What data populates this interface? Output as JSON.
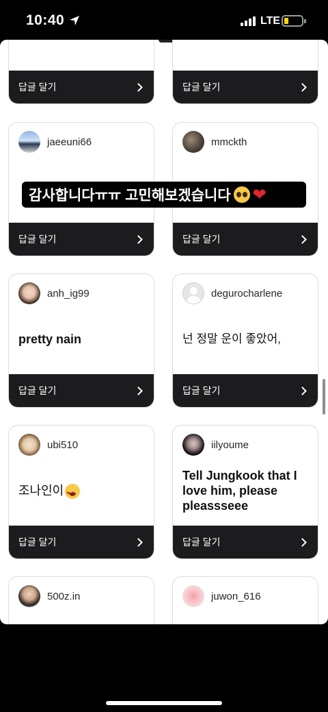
{
  "status_bar": {
    "time": "10:40",
    "network": "LTE",
    "location_icon": "location-arrow-icon",
    "battery_level": 0.2
  },
  "caption": {
    "text": "감사합니다ㅠㅠ 고민해보겠습니다",
    "emojis": [
      "pleading-face",
      "red-heart"
    ]
  },
  "reply_label": "답글 달기",
  "cards": [
    {
      "username": "",
      "message": ""
    },
    {
      "username": "",
      "message": ""
    },
    {
      "username": "jaeeuni66",
      "message": ""
    },
    {
      "username": "mmckth",
      "message": ""
    },
    {
      "username": "anh_ig99",
      "message": "pretty nain"
    },
    {
      "username": "degurocharlene",
      "message": "넌 정말 운이 좋았어,"
    },
    {
      "username": "ubi510",
      "message": "조나인이"
    },
    {
      "username": "iilyoume",
      "message": "Tell Jungkook that I love him, please pleassseee"
    },
    {
      "username": "500z.in",
      "message": ""
    },
    {
      "username": "juwon_616",
      "message": ""
    }
  ],
  "colors": {
    "footer": "#1c1c1e",
    "card_border": "#dcdcdc",
    "battery": "#ffd60a"
  }
}
